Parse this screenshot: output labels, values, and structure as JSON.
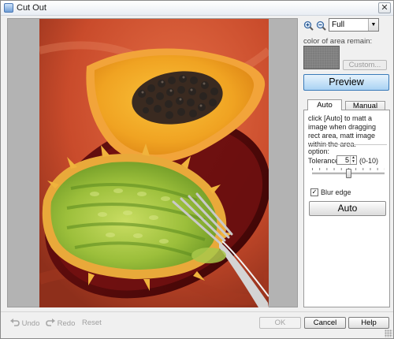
{
  "window": {
    "title": "Cut Out",
    "close_glyph": "✕"
  },
  "toolbar": {
    "zoom_in_icon": "zoom-in-icon",
    "zoom_out_icon": "zoom-out-icon",
    "zoom_value": "Full"
  },
  "side": {
    "remain_label": "color of area remain:",
    "custom_label": "Custom...",
    "preview_label": "Preview"
  },
  "tabs": {
    "auto_label": "Auto",
    "manual_label": "Manual"
  },
  "auto_panel": {
    "description": "click [Auto] to matt a image when dragging rect area, matt image within the area.",
    "option_label": "option:",
    "tolerance_label": "Tolerance:",
    "tolerance_value": "5",
    "tolerance_range": "(0-10)",
    "tolerance_min": 0,
    "tolerance_max": 10,
    "blur_edge_label": "Blur edge",
    "blur_edge_checked": true,
    "auto_button": "Auto"
  },
  "footer": {
    "undo_label": "Undo",
    "redo_label": "Redo",
    "reset_label": "Reset",
    "ok_label": "OK",
    "cancel_label": "Cancel",
    "help_label": "Help"
  },
  "colors": {
    "preview_button": "#a9d2f3",
    "swatch": "#7d7d7d"
  }
}
